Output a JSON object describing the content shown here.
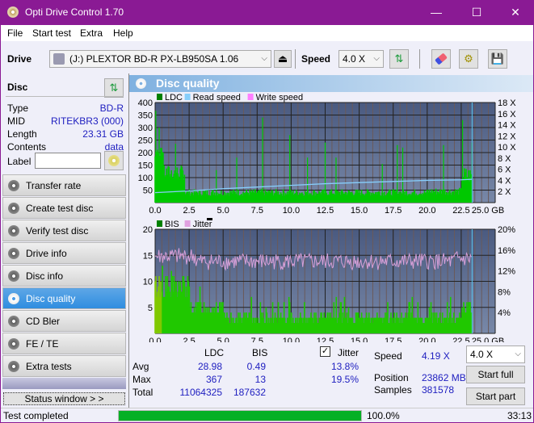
{
  "window": {
    "title": "Opti Drive Control 1.70",
    "minimize": "—",
    "maximize": "☐",
    "close": "✕"
  },
  "menu": {
    "items": [
      "File",
      "Start test",
      "Extra",
      "Help"
    ]
  },
  "toolbar": {
    "drive_label": "Drive",
    "drive_value": "(J:)  PLEXTOR BD-R  PX-LB950SA 1.06",
    "speed_label": "Speed",
    "speed_value": "4.0 X",
    "icons": [
      "drive-icon",
      "eject-icon",
      "refresh-icon",
      "erase-icon",
      "settings-icon",
      "save-icon"
    ]
  },
  "disc": {
    "header": "Disc",
    "rows": [
      {
        "label": "Type",
        "value": "BD-R"
      },
      {
        "label": "MID",
        "value": "RITEKBR3 (000)"
      },
      {
        "label": "Length",
        "value": "23.31 GB"
      },
      {
        "label": "Contents",
        "value": "data"
      }
    ],
    "label_field_label": "Label",
    "label_field_value": ""
  },
  "nav": {
    "items": [
      "Transfer rate",
      "Create test disc",
      "Verify test disc",
      "Drive info",
      "Disc info",
      "Disc quality",
      "CD Bler",
      "FE / TE",
      "Extra tests"
    ],
    "active": "Disc quality"
  },
  "status_window_button": "Status window > >",
  "main": {
    "title": "Disc quality"
  },
  "chart_data": [
    {
      "type": "bar",
      "title": "LDC / Read speed",
      "legend": [
        "LDC",
        "Read speed",
        "Write speed"
      ],
      "legend_colors": [
        "#008000",
        "#87cefa",
        "#ff80ff"
      ],
      "x_ticks": [
        "0.0",
        "2.5",
        "5.0",
        "7.5",
        "10.0",
        "12.5",
        "15.0",
        "17.5",
        "20.0",
        "22.5",
        "25.0 GB"
      ],
      "xlim": [
        0,
        25
      ],
      "y_ticks": [
        "50",
        "100",
        "150",
        "200",
        "250",
        "300",
        "350",
        "400"
      ],
      "ylim": [
        0,
        400
      ],
      "y2_ticks": [
        "2 X",
        "4 X",
        "6 X",
        "8 X",
        "10 X",
        "12 X",
        "14 X",
        "16 X",
        "18 X"
      ],
      "y2lim": [
        0,
        18
      ],
      "read_speed": {
        "x": [
          0,
          2.5,
          5,
          7.5,
          10,
          12.5,
          15,
          17.5,
          20,
          22.5,
          23.3
        ],
        "y": [
          1.8,
          2.1,
          2.5,
          2.8,
          3.1,
          3.4,
          3.6,
          3.8,
          4.0,
          4.1,
          4.2
        ]
      },
      "ldc_peaks": {
        "x": [
          0.05,
          0.3,
          0.6,
          1.5,
          4.5,
          6,
          7.9,
          9.9,
          11.2,
          12.5,
          13.3,
          16.7,
          17.8,
          18.2,
          21.2,
          22.6,
          23.3
        ],
        "y": [
          367,
          300,
          200,
          235,
          130,
          180,
          340,
          270,
          180,
          240,
          180,
          155,
          230,
          220,
          230,
          330,
          240
        ]
      },
      "ldc_baseline": [
        45,
        45,
        45,
        45,
        45,
        45,
        45,
        45,
        50,
        120,
        180
      ],
      "end_marker_x": 23.3
    },
    {
      "type": "bar",
      "title": "BIS / Jitter",
      "legend": [
        "BIS",
        "Jitter"
      ],
      "legend_colors": [
        "#008000",
        "#e0a0e0"
      ],
      "x_ticks": [
        "0.0",
        "2.5",
        "5.0",
        "7.5",
        "10.0",
        "12.5",
        "15.0",
        "17.5",
        "20.0",
        "22.5",
        "25.0 GB"
      ],
      "xlim": [
        0,
        25
      ],
      "y_ticks": [
        "5",
        "10",
        "15",
        "20"
      ],
      "ylim": [
        0,
        20
      ],
      "y2_ticks": [
        "4%",
        "8%",
        "12%",
        "16%",
        "20%"
      ],
      "y2lim": [
        0,
        20
      ],
      "jitter_avg": 13.8,
      "jitter_max": 19.5,
      "bis_baseline": [
        9,
        5,
        3,
        3,
        3,
        3,
        3,
        3,
        3,
        5,
        6
      ],
      "end_marker_x": 23.3
    }
  ],
  "stats": {
    "col_ldc": "LDC",
    "col_bis": "BIS",
    "jitter_label": "Jitter",
    "jitter_checked": true,
    "rows": [
      {
        "label": "Avg",
        "ldc": "28.98",
        "bis": "0.49",
        "jitter": "13.8%"
      },
      {
        "label": "Max",
        "ldc": "367",
        "bis": "13",
        "jitter": "19.5%"
      },
      {
        "label": "Total",
        "ldc": "11064325",
        "bis": "187632",
        "jitter": ""
      }
    ],
    "speed_label": "Speed",
    "speed_value": "4.19 X",
    "position_label": "Position",
    "position_value": "23862 MB",
    "samples_label": "Samples",
    "samples_value": "381578",
    "speed_select": "4.0 X",
    "start_full": "Start full",
    "start_part": "Start part"
  },
  "statusbar": {
    "text": "Test completed",
    "progress": 100.0,
    "progress_text": "100.0%",
    "time": "33:13"
  }
}
